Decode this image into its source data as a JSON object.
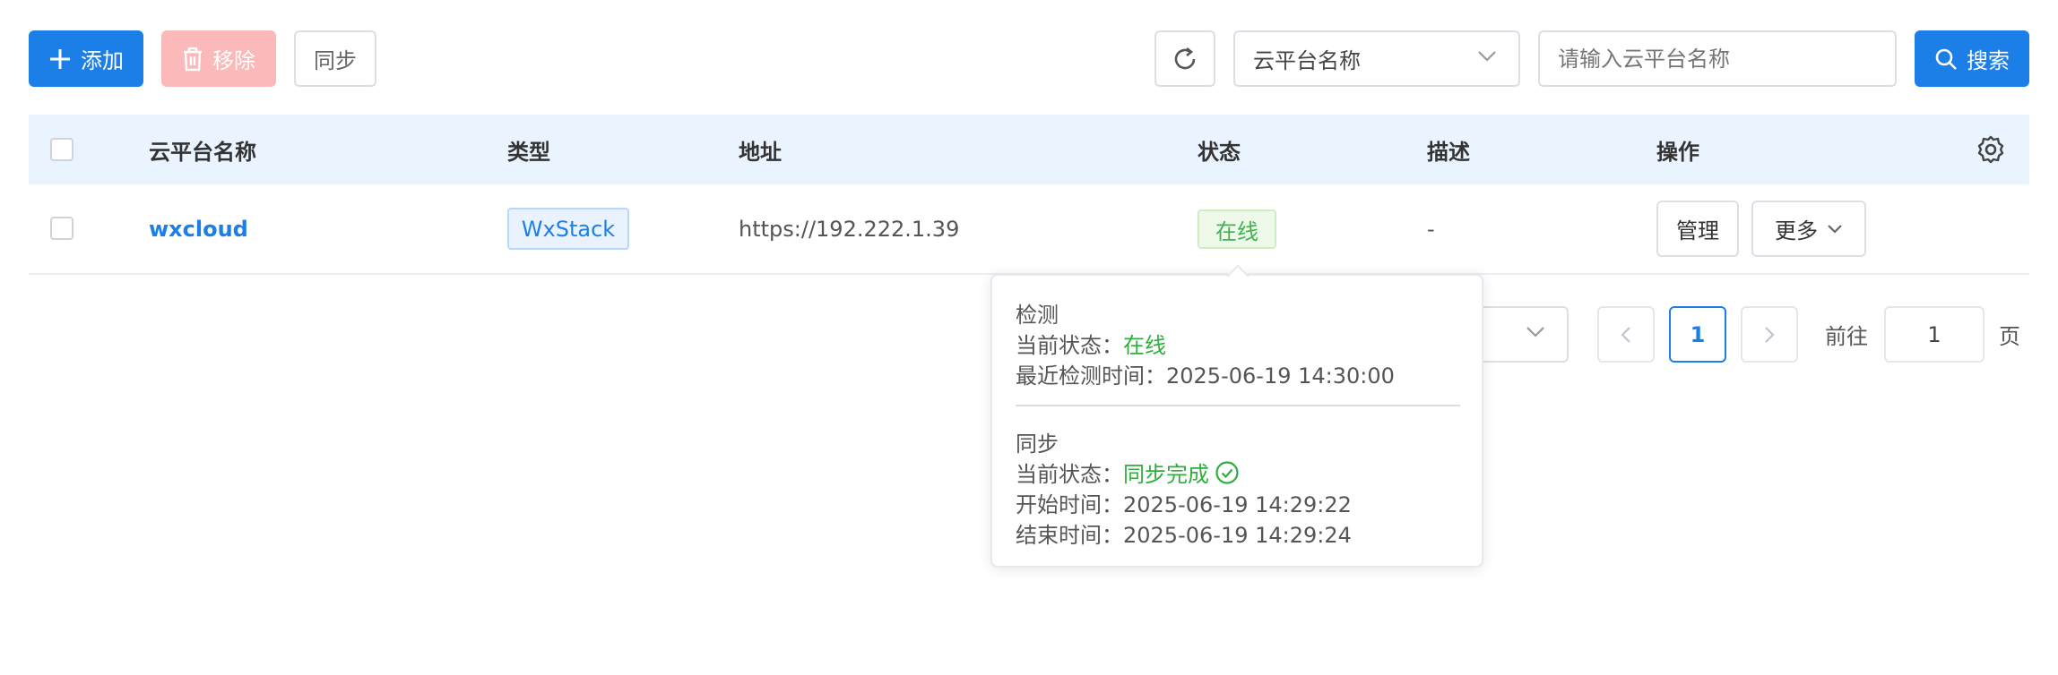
{
  "toolbar": {
    "add_label": "添加",
    "remove_label": "移除",
    "sync_label": "同步",
    "search_field_select": "云平台名称",
    "search_placeholder": "请输入云平台名称",
    "search_button_label": "搜索"
  },
  "table": {
    "columns": [
      "云平台名称",
      "类型",
      "地址",
      "状态",
      "描述",
      "操作"
    ],
    "rows": [
      {
        "name": "wxcloud",
        "type": "WxStack",
        "address": "https://192.222.1.39",
        "status": "在线",
        "description": "-",
        "actions": {
          "manage": "管理",
          "more": "更多"
        }
      }
    ]
  },
  "pagination": {
    "current_page": "1",
    "goto_label": "前往",
    "goto_value": "1",
    "page_suffix": "页"
  },
  "status_popover": {
    "check_title": "检测",
    "check_status_label": "当前状态：",
    "check_status_value": "在线",
    "check_time_label": "最近检测时间：",
    "check_time_value": "2025-06-19 14:30:00",
    "sync_title": "同步",
    "sync_status_label": "当前状态：",
    "sync_status_value": "同步完成",
    "sync_start_label": "开始时间：",
    "sync_start_value": "2025-06-19 14:29:22",
    "sync_end_label": "结束时间：",
    "sync_end_value": "2025-06-19 14:29:24"
  },
  "colors": {
    "primary": "#1c7fe8",
    "danger_disabled": "#fbb9b9",
    "success": "#2fad3e",
    "table_header_bg": "#eaf4ff"
  }
}
